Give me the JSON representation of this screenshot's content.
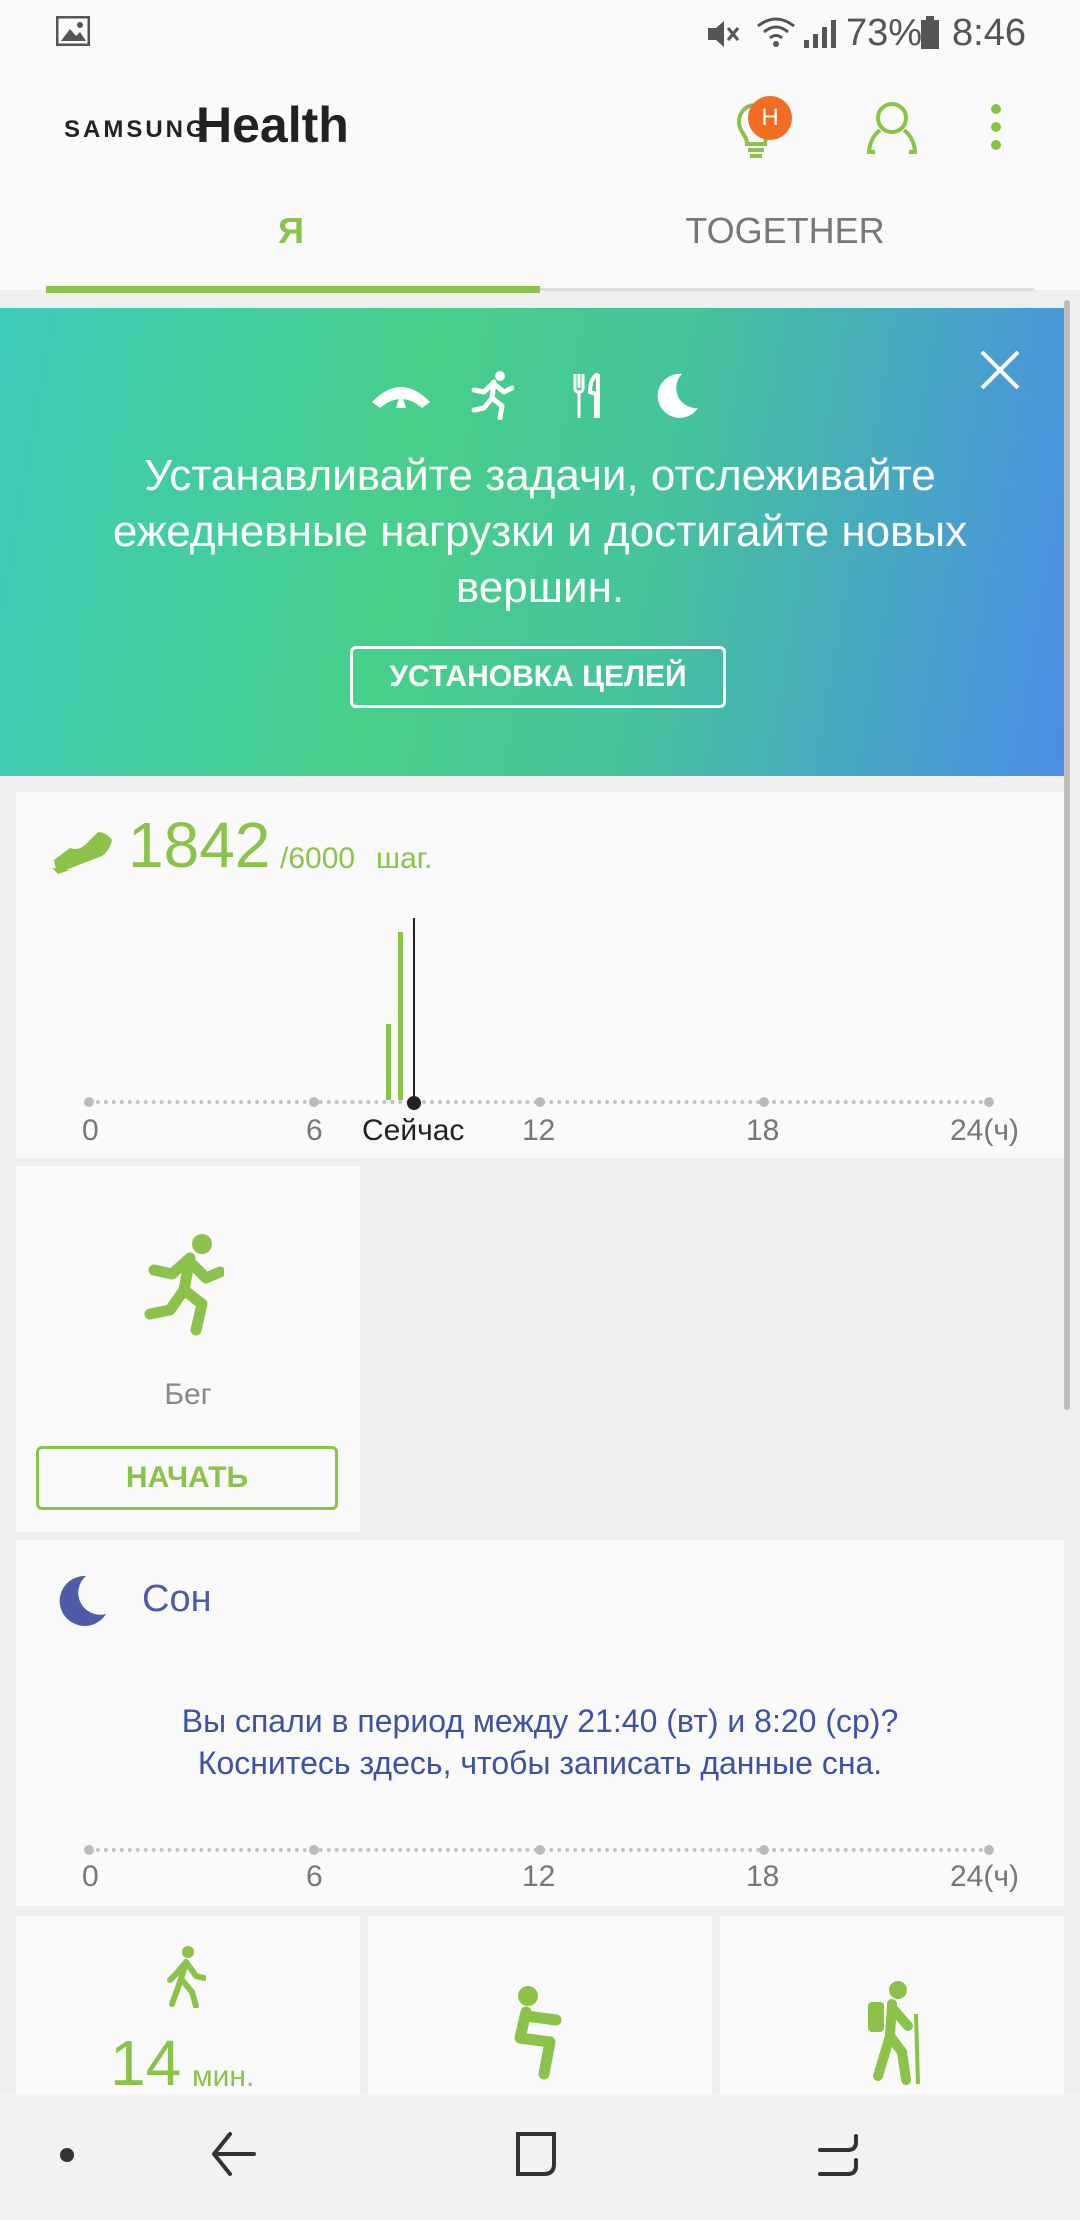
{
  "status_bar": {
    "battery": "73%",
    "time": "8:46"
  },
  "app": {
    "brand_small": "SAMSUNG",
    "brand_large": "Health",
    "notification_badge": "H"
  },
  "tabs": [
    {
      "label": "Я",
      "active": true
    },
    {
      "label": "TOGETHER",
      "active": false
    }
  ],
  "banner": {
    "text": "Устанавливайте задачи, отслеживайте ежедневные нагрузки и достигайте новых вершин.",
    "button": "УСТАНОВКА ЦЕЛЕЙ"
  },
  "steps": {
    "count": "1842",
    "goal": "/6000",
    "unit": "шаг.",
    "axis_labels": [
      "0",
      "6",
      "Сейчас",
      "12",
      "18",
      "24(ч)"
    ]
  },
  "running": {
    "label": "Бег",
    "button": "НАЧАТЬ"
  },
  "sleep": {
    "title": "Сон",
    "message_line1": "Вы спали в период между 21:40 (вт) и 8:20 (ср)?",
    "message_line2": "Коснитесь здесь, чтобы записать данные сна.",
    "axis_labels": [
      "0",
      "6",
      "12",
      "18",
      "24(ч)"
    ]
  },
  "activity": {
    "value": "14",
    "unit": "мин."
  },
  "colors": {
    "accent_green": "#8bc34a",
    "sleep_blue": "#4f5ba8",
    "badge_orange": "#f26c21"
  }
}
